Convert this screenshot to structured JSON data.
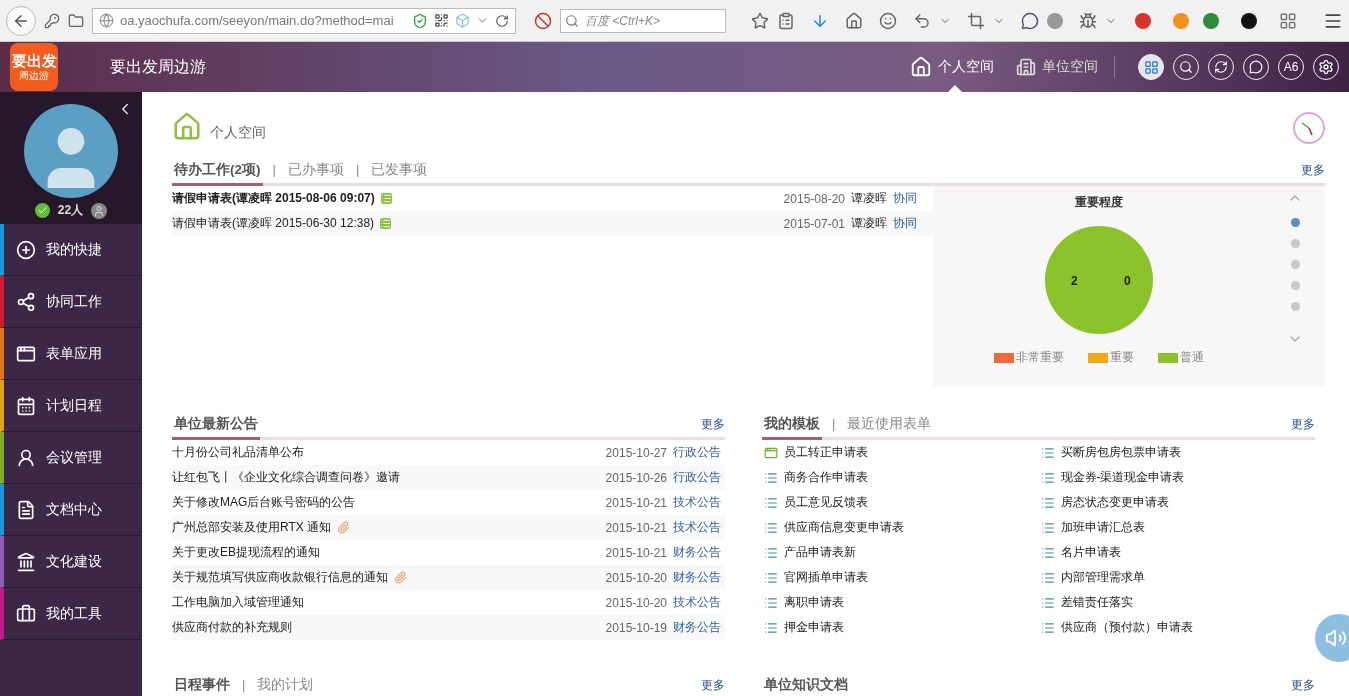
{
  "browser": {
    "url": "oa.yaochufa.com/seeyon/main.do?method=mai",
    "search": {
      "placeholder": "百度 <Ctrl+K>"
    }
  },
  "header": {
    "logo": {
      "main": "要出发",
      "sub": "周边游"
    },
    "title": "要出发周边游",
    "spaces": [
      {
        "label": "个人空间",
        "selected": true
      },
      {
        "label": "单位空间",
        "selected": false
      }
    ],
    "badge": "A6"
  },
  "sidebar": {
    "online": "22人",
    "items": [
      {
        "label": "我的快捷",
        "color": "#1a9bd7",
        "kind": "plus"
      },
      {
        "label": "协同工作",
        "color": "#d21b2e",
        "kind": "share"
      },
      {
        "label": "表单应用",
        "color": "#e0761c",
        "kind": "form"
      },
      {
        "label": "计划日程",
        "color": "#e0a21c",
        "kind": "calendar"
      },
      {
        "label": "会议管理",
        "color": "#7fae2a",
        "kind": "meeting"
      },
      {
        "label": "文档中心",
        "color": "#1a9bd7",
        "kind": "doc"
      },
      {
        "label": "文化建设",
        "color": "#8e5cb5",
        "kind": "culture"
      },
      {
        "label": "我的工具",
        "color": "#c2188f",
        "kind": "tools"
      }
    ]
  },
  "page_title": "个人空间",
  "pending": {
    "separator": "|",
    "tabs": [
      {
        "label": "待办工作(2项)",
        "selected": true
      },
      {
        "label": "已办事项",
        "selected": false
      },
      {
        "label": "已发事项",
        "selected": false
      }
    ],
    "more": "更多",
    "rows": [
      {
        "title": "请假申请表(谭凌晖 2015-08-06 09:07)",
        "unread": true,
        "date": "2015-08-20",
        "sender": "谭凌晖",
        "type": "协同"
      },
      {
        "title": "请假申请表(谭凌晖 2015-06-30 12:38)",
        "unread": false,
        "date": "2015-07-01",
        "sender": "谭凌晖",
        "type": "协同"
      }
    ],
    "chart": {
      "chart_data": {
        "type": "pie",
        "title": "重要程度",
        "categories": [
          "非常重要",
          "重要",
          "普通"
        ],
        "series": [
          {
            "values": [
              0,
              0,
              100
            ]
          }
        ],
        "colors": [
          "#ee6a3c",
          "#f0a814",
          "#8cc22c"
        ]
      },
      "slice_labels": [
        "2",
        "0"
      ],
      "pages": [
        {
          "selected": true
        },
        {
          "selected": false
        },
        {
          "selected": false
        },
        {
          "selected": false
        },
        {
          "selected": false
        }
      ]
    }
  },
  "notices": {
    "title": "单位最新公告",
    "more": "更多",
    "rows": [
      {
        "title": "十月份公司礼品清单公布",
        "attachment": false,
        "date": "2015-10-27",
        "type": "行政公告"
      },
      {
        "title": "让红包飞丨《企业文化综合调查问卷》邀请",
        "attachment": false,
        "date": "2015-10-26",
        "type": "行政公告"
      },
      {
        "title": "关于修改MAG后台账号密码的公告",
        "attachment": false,
        "date": "2015-10-21",
        "type": "技术公告"
      },
      {
        "title": "广州总部安装及使用RTX 通知",
        "attachment": true,
        "date": "2015-10-21",
        "type": "技术公告"
      },
      {
        "title": "关于更改EB提现流程的通知",
        "attachment": false,
        "date": "2015-10-21",
        "type": "财务公告"
      },
      {
        "title": "关于规范填写供应商收款银行信息的通知",
        "attachment": true,
        "date": "2015-10-20",
        "type": "财务公告"
      },
      {
        "title": "工作电脑加入域管理通知",
        "attachment": false,
        "date": "2015-10-20",
        "type": "技术公告"
      },
      {
        "title": "供应商付款的补充规则",
        "attachment": false,
        "date": "2015-10-19",
        "type": "财务公告"
      }
    ]
  },
  "templates": {
    "separator": "|",
    "tabs": [
      {
        "label": "我的模板",
        "selected": true
      },
      {
        "label": "最近使用表单",
        "selected": false
      }
    ],
    "more": "更多",
    "items": [
      {
        "label": "员工转正申请表",
        "kind": "workflow"
      },
      {
        "label": "买断房包房包票申请表",
        "kind": "form"
      },
      {
        "label": "商务合作申请表",
        "kind": "form"
      },
      {
        "label": "现金券-渠道现金申请表",
        "kind": "form"
      },
      {
        "label": "员工意见反馈表",
        "kind": "form"
      },
      {
        "label": "房态状态变更申请表",
        "kind": "form"
      },
      {
        "label": "供应商信息变更申请表",
        "kind": "form"
      },
      {
        "label": "加班申请汇总表",
        "kind": "form"
      },
      {
        "label": "产品申请表新",
        "kind": "form"
      },
      {
        "label": "名片申请表",
        "kind": "form"
      },
      {
        "label": "官网插单申请表",
        "kind": "form"
      },
      {
        "label": "内部管理需求单",
        "kind": "form"
      },
      {
        "label": "离职申请表",
        "kind": "form"
      },
      {
        "label": "差错责任落实",
        "kind": "form"
      },
      {
        "label": "押金申请表",
        "kind": "form"
      },
      {
        "label": "供应商（预付款）申请表",
        "kind": "form"
      }
    ]
  },
  "schedule": {
    "separator": "|",
    "tabs": [
      {
        "label": "日程事件",
        "selected": true
      },
      {
        "label": "我的计划",
        "selected": false
      }
    ],
    "more": "更多"
  },
  "knowledge": {
    "title": "单位知识文档",
    "more": "更多"
  }
}
